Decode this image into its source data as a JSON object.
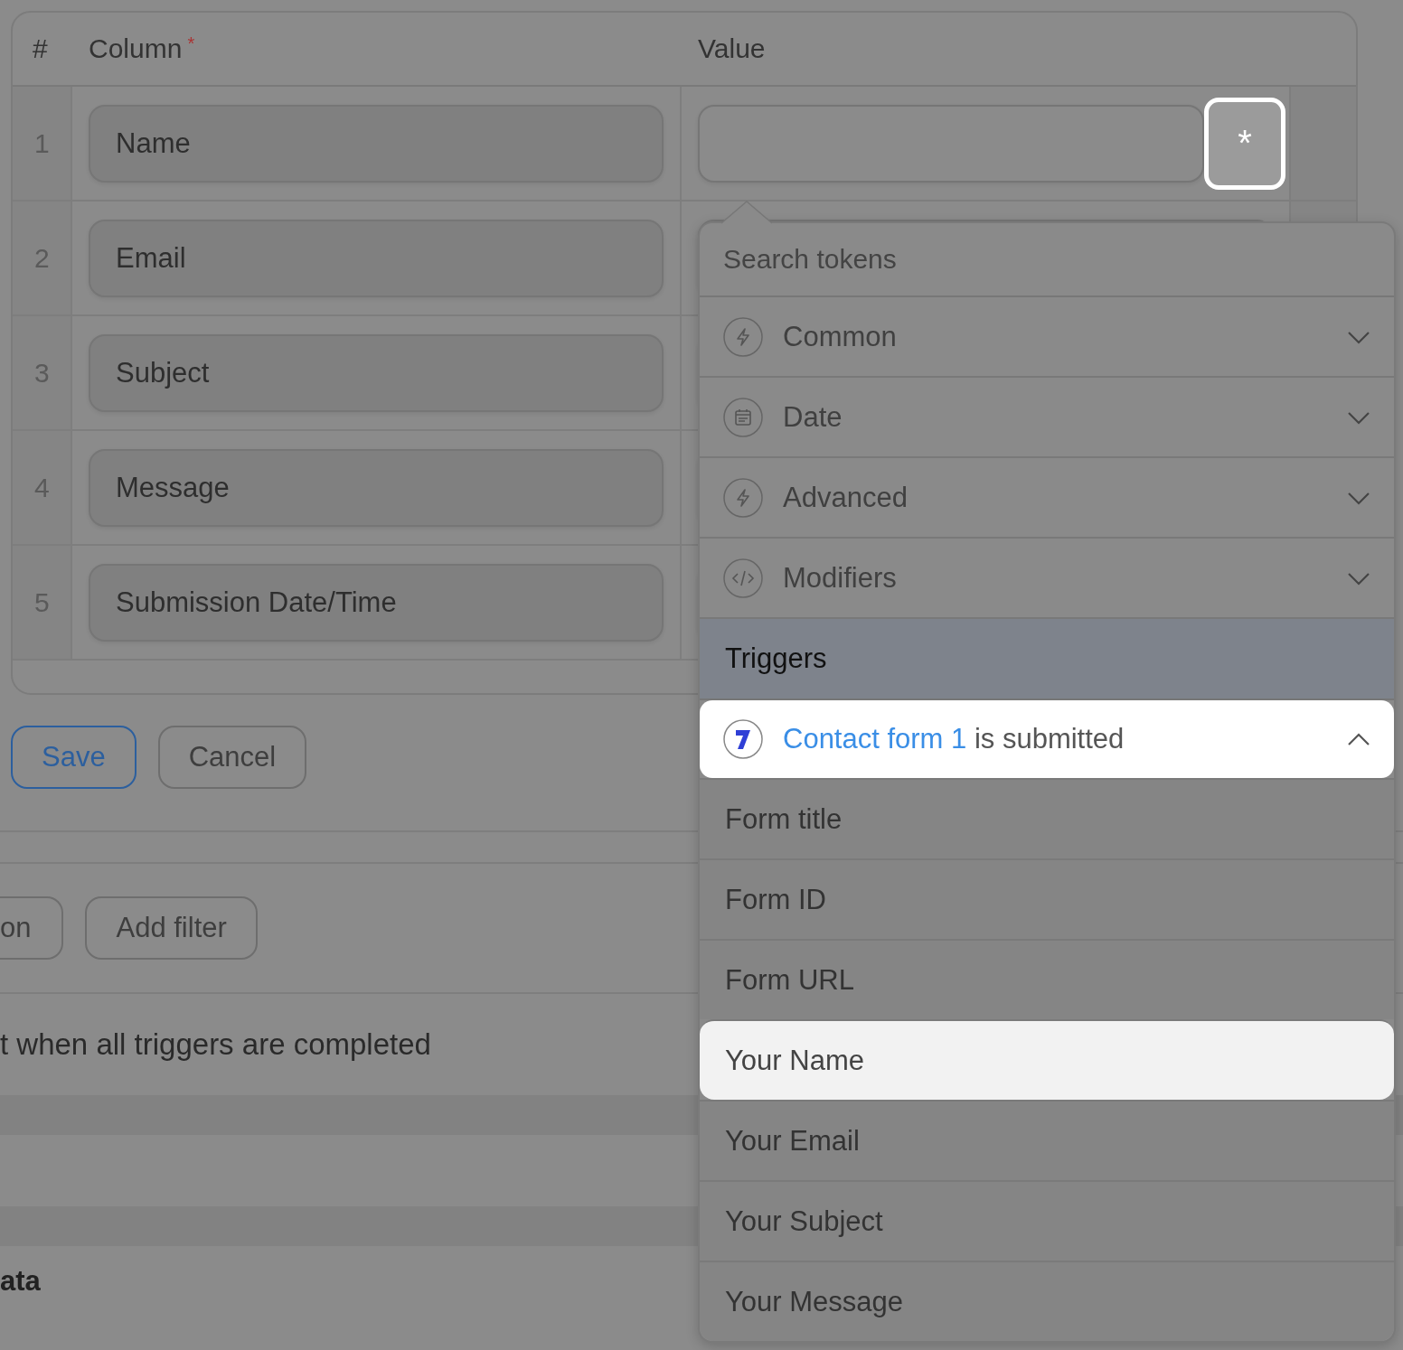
{
  "table": {
    "columns": [
      {
        "label": "#"
      },
      {
        "label": "Column",
        "required": true
      },
      {
        "label": "Value"
      }
    ],
    "rows": [
      {
        "number": "1",
        "column": "Name",
        "value": "",
        "token_button": "*"
      },
      {
        "number": "2",
        "column": "Email",
        "value": ""
      },
      {
        "number": "3",
        "column": "Subject",
        "value": ""
      },
      {
        "number": "4",
        "column": "Message",
        "value": ""
      },
      {
        "number": "5",
        "column": "Submission Date/Time",
        "value": ""
      }
    ]
  },
  "form_buttons": [
    {
      "label": "Save",
      "kind": "primary"
    },
    {
      "label": "Cancel",
      "kind": "secondary"
    }
  ],
  "filter_buttons": [
    "on",
    "Add filter"
  ],
  "trigger_note": "t when all triggers are completed",
  "section_label": "ata",
  "token_popover": {
    "search": {
      "placeholder": "Search tokens"
    },
    "groups": [
      {
        "label": "Common",
        "kind": "bolt",
        "expanded": false
      },
      {
        "label": "Date",
        "kind": "calendar",
        "expanded": false
      },
      {
        "label": "Advanced",
        "kind": "bolt",
        "expanded": false
      },
      {
        "label": "Modifiers",
        "kind": "code",
        "expanded": false
      }
    ],
    "section_title": "Triggers",
    "trigger": {
      "form": "Contact form 1",
      "text": "is submitted",
      "expanded": true,
      "highlighted": true
    },
    "items": [
      {
        "label": "Form title",
        "highlighted": false
      },
      {
        "label": "Form ID",
        "highlighted": false
      },
      {
        "label": "Form URL",
        "highlighted": false
      },
      {
        "label": "Your Name",
        "highlighted": true
      },
      {
        "label": "Your Email",
        "highlighted": false
      },
      {
        "label": "Your Subject",
        "highlighted": false
      },
      {
        "label": "Your Message",
        "highlighted": false
      }
    ]
  }
}
